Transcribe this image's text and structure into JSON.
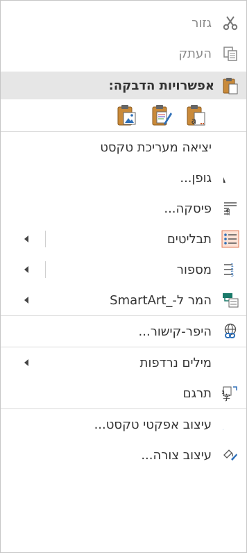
{
  "menu": {
    "cut": {
      "label": "גזור",
      "icon": "scissors-icon",
      "enabled": false
    },
    "copy": {
      "label": "העתק",
      "icon": "copy-icon",
      "enabled": false
    },
    "paste_options_header": "אפשרויות הדבקה:",
    "paste_options": [
      {
        "icon": "paste-picture-icon"
      },
      {
        "icon": "paste-keep-source-formatting-icon"
      },
      {
        "icon": "paste-keep-text-only-icon"
      }
    ],
    "exit_text_edit": "יציאה מעריכת טקסט",
    "font": "גופן...",
    "paragraph": "פיסקה...",
    "bullets": "תבליטים",
    "numbering": "מספור",
    "convert_smartart": "המר ל-_SmartArt",
    "hyperlink": "היפר-קישור...",
    "synonyms": "מילים נרדפות",
    "translate": "תרגם",
    "format_text_effects": "עיצוב אפקטי טקסט...",
    "format_shape": "עיצוב צורה..."
  },
  "colors": {
    "accent_orange": "#d15b2b",
    "accent_blue": "#2e6fb8",
    "teal": "#1a7a6a"
  }
}
